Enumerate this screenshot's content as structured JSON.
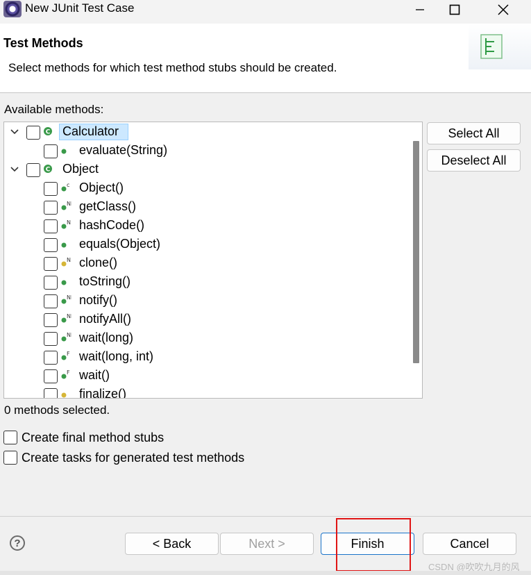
{
  "window": {
    "title": "New JUnit Test Case"
  },
  "header": {
    "title": "Test Methods",
    "description": "Select methods for which test method stubs should be created."
  },
  "available_label": "Available methods:",
  "tree": [
    {
      "kind": "class",
      "label": "Calculator",
      "expanded": true,
      "selected": true,
      "icon": "class-icon"
    },
    {
      "kind": "method",
      "label": "evaluate(String)",
      "icon": "public-method-icon",
      "modifiers": ""
    },
    {
      "kind": "class",
      "label": "Object",
      "expanded": true,
      "selected": false,
      "icon": "class-icon"
    },
    {
      "kind": "method",
      "label": "Object()",
      "icon": "public-method-icon",
      "modifiers": "c"
    },
    {
      "kind": "method",
      "label": "getClass()",
      "icon": "public-method-icon",
      "modifiers": "NF"
    },
    {
      "kind": "method",
      "label": "hashCode()",
      "icon": "public-method-icon",
      "modifiers": "N"
    },
    {
      "kind": "method",
      "label": "equals(Object)",
      "icon": "public-method-icon",
      "modifiers": ""
    },
    {
      "kind": "method",
      "label": "clone()",
      "icon": "protected-method-icon",
      "modifiers": "N"
    },
    {
      "kind": "method",
      "label": "toString()",
      "icon": "public-method-icon",
      "modifiers": ""
    },
    {
      "kind": "method",
      "label": "notify()",
      "icon": "public-method-icon",
      "modifiers": "NF"
    },
    {
      "kind": "method",
      "label": "notifyAll()",
      "icon": "public-method-icon",
      "modifiers": "NF"
    },
    {
      "kind": "method",
      "label": "wait(long)",
      "icon": "public-method-icon",
      "modifiers": "NF"
    },
    {
      "kind": "method",
      "label": "wait(long, int)",
      "icon": "public-method-icon",
      "modifiers": "F"
    },
    {
      "kind": "method",
      "label": "wait()",
      "icon": "public-method-icon",
      "modifiers": "F"
    },
    {
      "kind": "method",
      "label": "finalize()",
      "icon": "protected-method-icon",
      "modifiers": ""
    }
  ],
  "side_buttons": {
    "select_all": "Select All",
    "deselect_all": "Deselect All"
  },
  "status": "0 methods selected.",
  "options": {
    "final_stubs": "Create final method stubs",
    "tasks": "Create tasks for generated test methods"
  },
  "footer": {
    "back": "< Back",
    "next": "Next >",
    "finish": "Finish",
    "cancel": "Cancel",
    "help": "?"
  },
  "watermark": "CSDN @吹吹九月的风",
  "colors": {
    "selection": "#cce8ff",
    "method_green": "#3a9a4a",
    "method_yellow": "#d6b637",
    "highlight_red": "#e01515"
  }
}
